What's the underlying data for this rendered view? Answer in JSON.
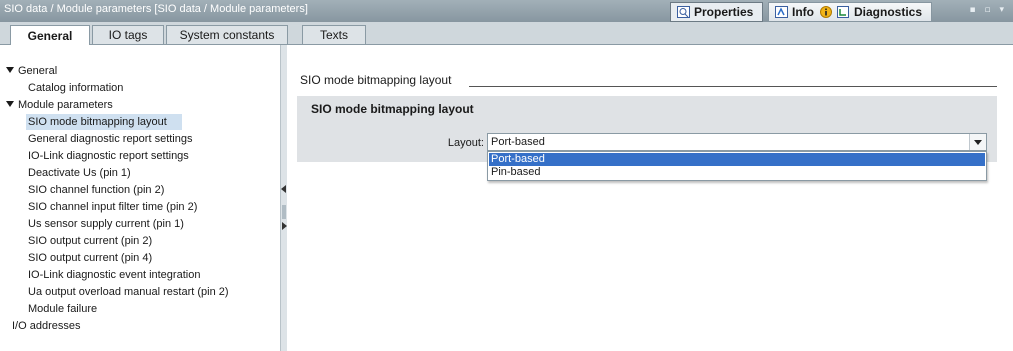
{
  "titlebar": {
    "title": "SIO data / Module parameters [SIO data / Module parameters]",
    "tabs": [
      {
        "label": "Properties",
        "icon": "properties-icon"
      },
      {
        "label": "Info",
        "icon": "info-icon"
      },
      {
        "label": "Diagnostics",
        "icon": "diagnostics-icon"
      }
    ],
    "controls": "▪ ▫ ▾"
  },
  "tabs": [
    {
      "label": "General",
      "active": true
    },
    {
      "label": "IO tags",
      "active": false
    },
    {
      "label": "System constants",
      "active": false
    },
    {
      "label": "Texts",
      "active": false
    }
  ],
  "tree": {
    "items": [
      {
        "label": "General",
        "level": 0,
        "expanded": true
      },
      {
        "label": "Catalog information",
        "level": 1
      },
      {
        "label": "Module parameters",
        "level": 0,
        "expanded": true
      },
      {
        "label": "SIO mode bitmapping layout",
        "level": 1,
        "selected": true
      },
      {
        "label": "General diagnostic report settings",
        "level": 1
      },
      {
        "label": "IO-Link diagnostic report settings",
        "level": 1
      },
      {
        "label": "Deactivate Us (pin 1)",
        "level": 1
      },
      {
        "label": "SIO channel function (pin 2)",
        "level": 1
      },
      {
        "label": "SIO channel input filter time (pin 2)",
        "level": 1
      },
      {
        "label": "Us sensor supply current (pin 1)",
        "level": 1
      },
      {
        "label": "SIO output current (pin 2)",
        "level": 1
      },
      {
        "label": "SIO output current (pin 4)",
        "level": 1
      },
      {
        "label": "IO-Link diagnostic event integration",
        "level": 1
      },
      {
        "label": "Ua output overload manual restart (pin 2)",
        "level": 1
      },
      {
        "label": "Module failure",
        "level": 1
      },
      {
        "label": "I/O addresses",
        "level": 0
      }
    ]
  },
  "panel": {
    "section_title": "SIO mode bitmapping layout",
    "group_title": "SIO mode bitmapping layout",
    "layout_label": "Layout:",
    "layout_value": "Port-based",
    "options": [
      "Port-based",
      "Pin-based"
    ]
  },
  "colors": {
    "titlebar": "#8796a0",
    "selection": "#3570c8",
    "tree_selected": "#cfe0f0",
    "group_bg": "#dfe2e5"
  }
}
